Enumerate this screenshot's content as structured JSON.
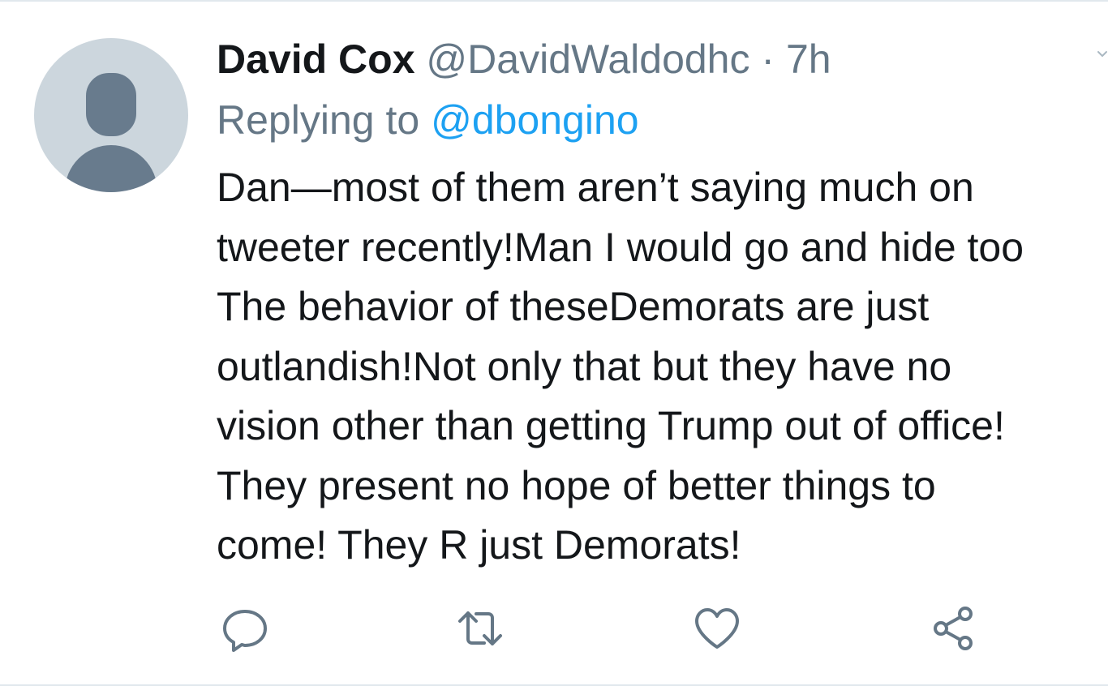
{
  "tweet": {
    "author_name": "David Cox",
    "author_handle": "@DavidWaldodhc",
    "separator": "·",
    "time": "7h",
    "replying_label": "Replying to",
    "reply_to": "@dbongino",
    "text_lines": [
      "Dan—most of them aren’t saying much on",
      "tweeter recently!Man I would go and hide too",
      "The behavior of theseDemorats are just",
      "outlandish!Not only that but they have no",
      "vision other than getting Trump out of office!",
      "They present no hope of better things to",
      "come! They R just Demorats!"
    ]
  },
  "actions": [
    {
      "icon": "reply-icon"
    },
    {
      "icon": "retweet-icon"
    },
    {
      "icon": "like-icon"
    },
    {
      "icon": "share-icon"
    }
  ],
  "colors": {
    "text": "#14171a",
    "secondary": "#657786",
    "link": "#1da1f2",
    "avatar_bg": "#ccd6dd",
    "avatar_fg": "#687b8d",
    "border": "#e1e8ed"
  }
}
